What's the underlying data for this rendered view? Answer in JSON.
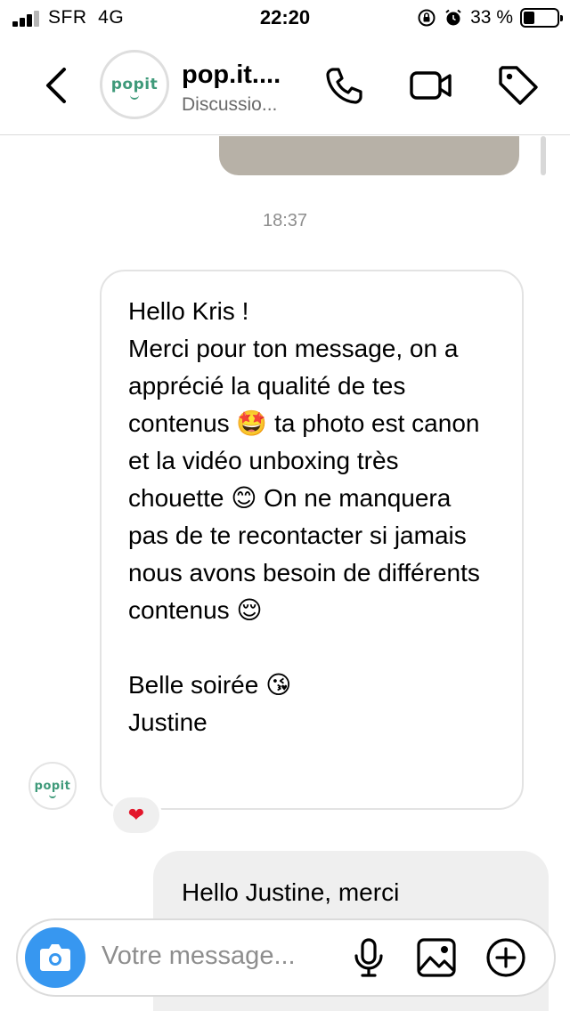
{
  "status_bar": {
    "carrier": "SFR",
    "network": "4G",
    "time": "22:20",
    "battery_percent": "33 %",
    "battery_level": 0.33
  },
  "header": {
    "avatar_logo": "popit",
    "title": "pop.it....",
    "subtitle": "Discussio..."
  },
  "conversation": {
    "timestamp": "18:37",
    "received_message": {
      "lines": [
        "Hello Kris !",
        "Merci pour ton message, on a apprécié la qualité de tes contenus 🤩 ta photo est canon et la vidéo unboxing très chouette 😊 On ne manquera pas de te recontacter si jamais nous avons besoin de différents contenus 😌",
        "Belle soirée 😘",
        "Justine"
      ],
      "sender_logo": "popit",
      "reaction": "❤"
    },
    "sent_message": {
      "text": "Hello Justine, merci"
    }
  },
  "composer": {
    "placeholder": "Votre message..."
  },
  "icons": {
    "back": "chevron-left-icon",
    "call": "phone-icon",
    "video": "video-camera-icon",
    "tag": "tag-icon",
    "camera": "camera-icon",
    "mic": "microphone-icon",
    "gallery": "image-icon",
    "add": "plus-circle-icon"
  },
  "colors": {
    "accent": "#3797f0",
    "brand_green": "#3f9a7a",
    "reaction_red": "#e3162b"
  }
}
